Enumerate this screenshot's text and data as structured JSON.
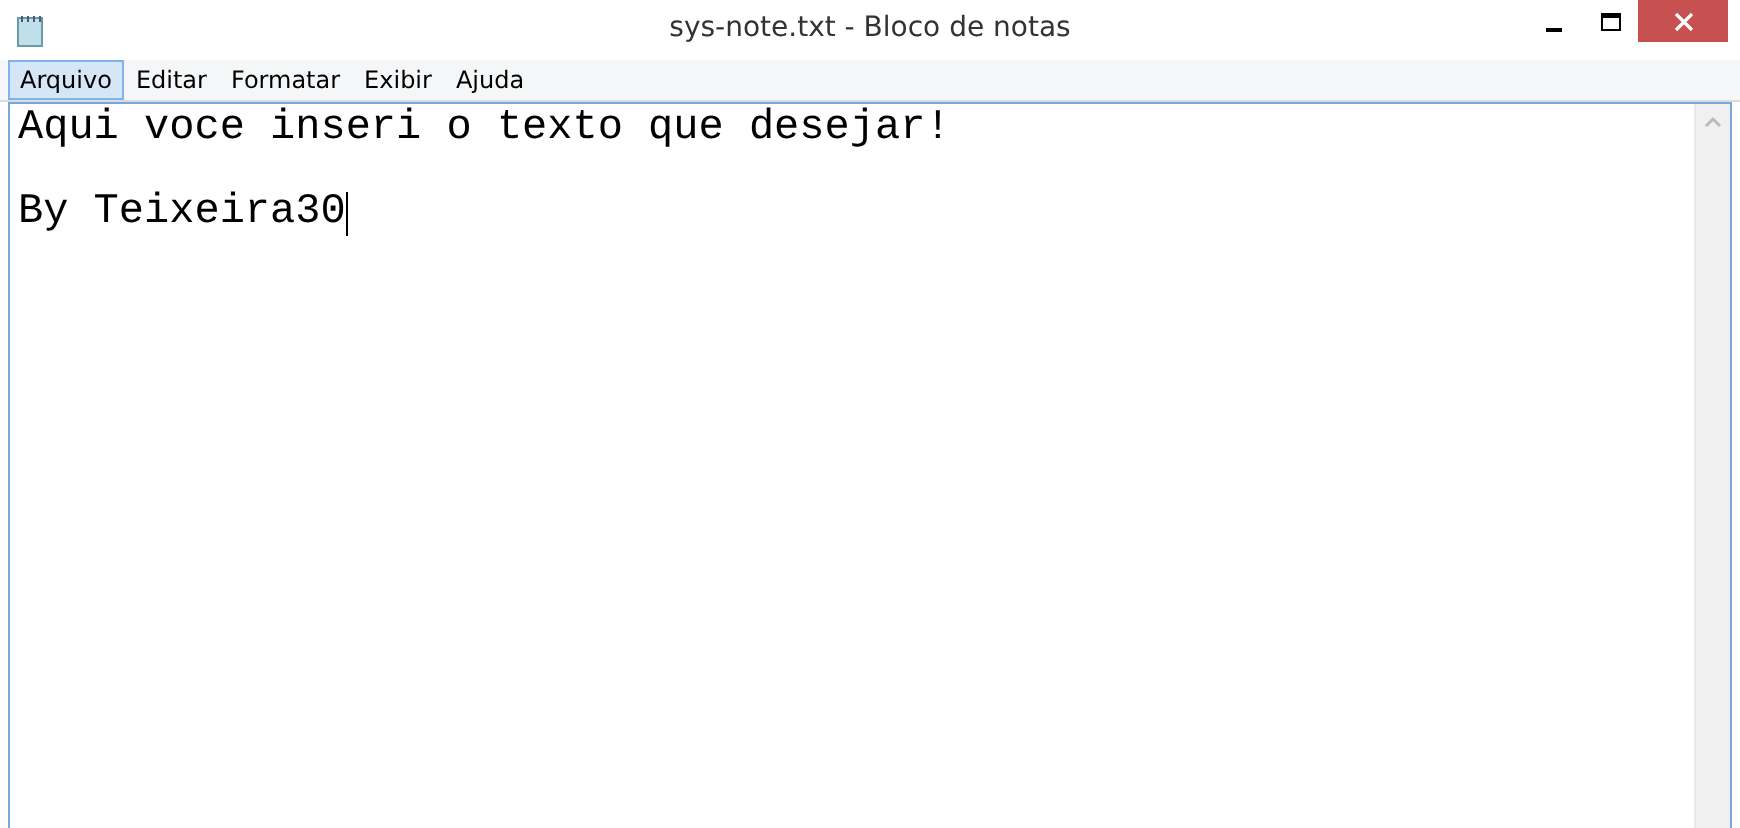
{
  "window": {
    "title": "sys-note.txt - Bloco de notas"
  },
  "menu": [
    {
      "label": "Arquivo",
      "selected": true
    },
    {
      "label": "Editar",
      "selected": false
    },
    {
      "label": "Formatar",
      "selected": false
    },
    {
      "label": "Exibir",
      "selected": false
    },
    {
      "label": "Ajuda",
      "selected": false
    }
  ],
  "editor": {
    "paragraphs": [
      "Aqui voce inseri o texto que desejar!",
      "By Teixeira30"
    ]
  }
}
